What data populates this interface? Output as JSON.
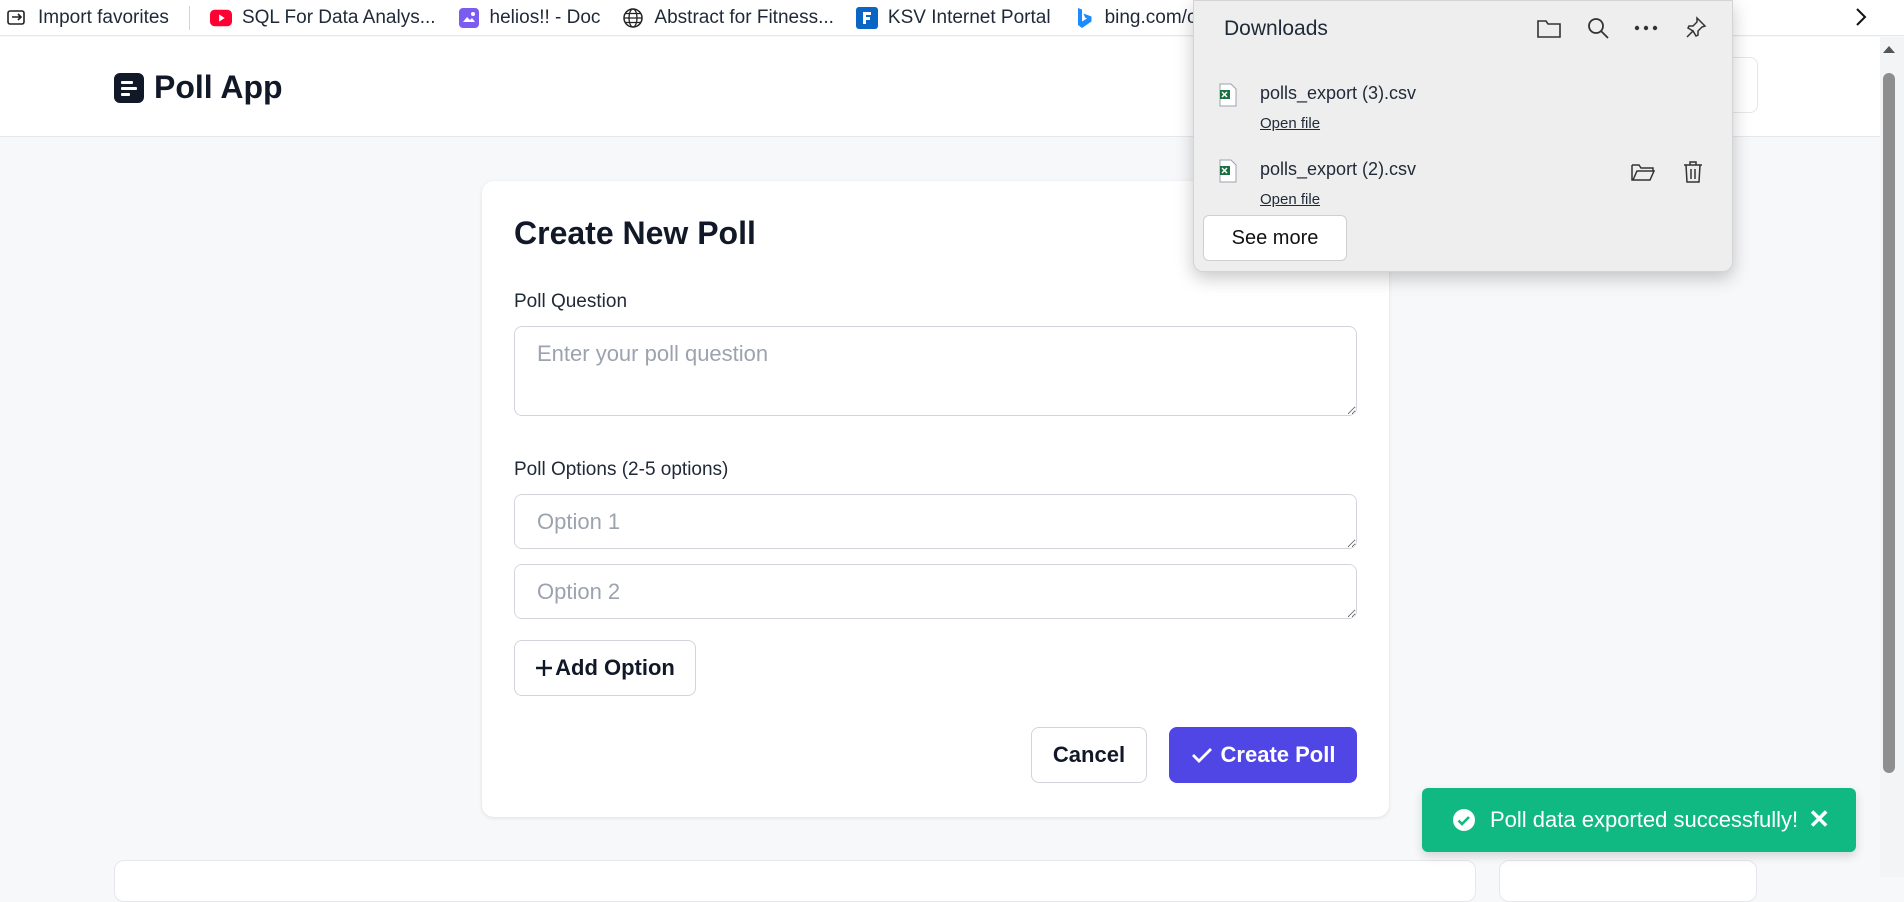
{
  "favorites_bar": {
    "items": [
      {
        "label": "Import favorites",
        "icon": "import-icon"
      },
      {
        "label": "SQL For Data Analys...",
        "icon": "youtube-icon"
      },
      {
        "label": "helios!! - Doc",
        "icon": "doc-icon"
      },
      {
        "label": "Abstract for Fitness...",
        "icon": "globe-icon"
      },
      {
        "label": "KSV Internet Portal",
        "icon": "ksv-icon"
      },
      {
        "label": "bing.com/ck/a",
        "icon": "bing-icon"
      }
    ]
  },
  "app": {
    "title": "Poll App"
  },
  "form": {
    "title": "Create New Poll",
    "question_label": "Poll Question",
    "question_placeholder": "Enter your poll question",
    "options_label": "Poll Options (2-5 options)",
    "options": [
      {
        "placeholder": "Option 1"
      },
      {
        "placeholder": "Option 2"
      }
    ],
    "add_option_label": "Add Option",
    "cancel_label": "Cancel",
    "create_label": "Create Poll"
  },
  "downloads": {
    "title": "Downloads",
    "items": [
      {
        "filename": "polls_export (3).csv",
        "action": "Open file"
      },
      {
        "filename": "polls_export (2).csv",
        "action": "Open file"
      }
    ],
    "see_more_label": "See more"
  },
  "toast": {
    "message": "Poll data exported successfully!",
    "close_symbol": "✕"
  },
  "colors": {
    "primary": "#4f46e5",
    "success": "#10b981",
    "text": "#111827"
  }
}
